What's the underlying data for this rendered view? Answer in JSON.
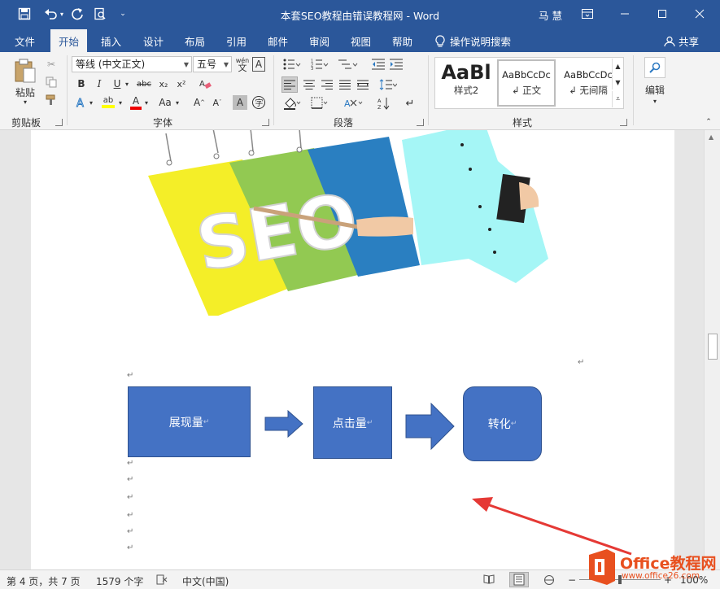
{
  "window": {
    "title": "本套SEO教程由错误教程网 - Word",
    "user": "马 慧"
  },
  "tabs": [
    "文件",
    "开始",
    "插入",
    "设计",
    "布局",
    "引用",
    "邮件",
    "审阅",
    "视图",
    "帮助"
  ],
  "active_tab": "开始",
  "tell_me": "操作说明搜索",
  "share": "共享",
  "ribbon": {
    "clipboard": {
      "paste": "粘贴",
      "label": "剪贴板"
    },
    "font": {
      "name": "等线 (中文正文)",
      "size": "五号",
      "label": "字体",
      "wen": "wén",
      "wen_char": "文"
    },
    "paragraph": {
      "label": "段落"
    },
    "styles": {
      "label": "样式",
      "items": [
        {
          "sample": "AaBl",
          "name": "样式2"
        },
        {
          "sample": "AaBbCcDc",
          "name": "正文"
        },
        {
          "sample": "AaBbCcDc",
          "name": "无间隔"
        }
      ]
    },
    "editing": {
      "label": "编辑"
    }
  },
  "document": {
    "flow": [
      "展现量",
      "点击量",
      "转化"
    ],
    "image_text": "SEO"
  },
  "status": {
    "page": "第 4 页，共 7 页",
    "words": "1579 个字",
    "lang": "中文(中国)",
    "zoom": "100%"
  },
  "watermark": {
    "brand": "Office教程网",
    "url": "www.office26.com"
  },
  "colors": {
    "accent": "#2b579a",
    "shape_fill": "#4472c4",
    "arrow_red": "#e53935"
  }
}
